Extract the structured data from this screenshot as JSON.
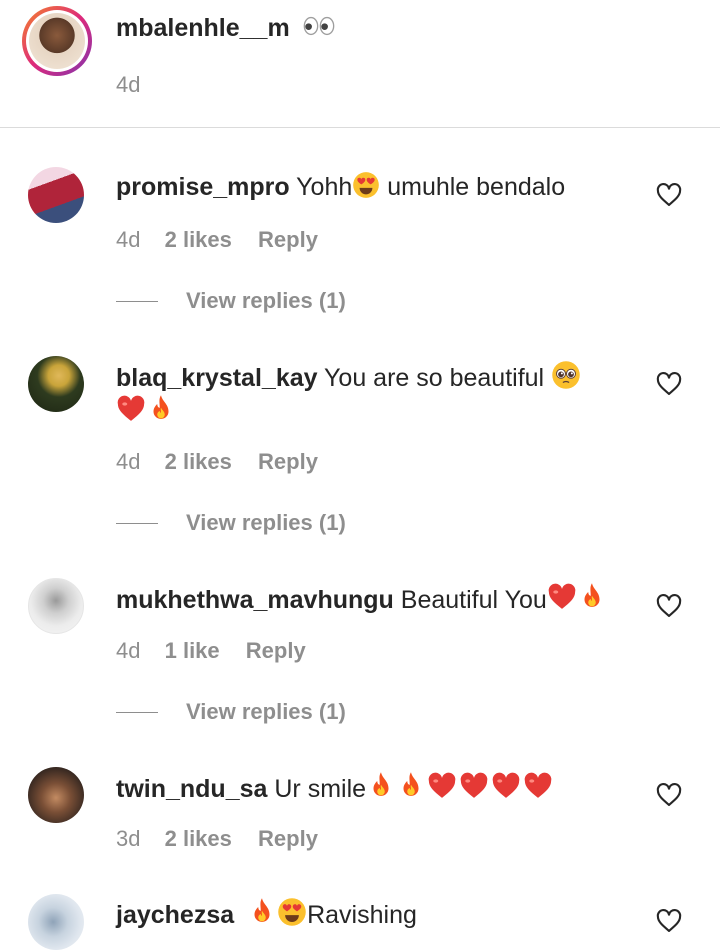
{
  "header": {
    "username": "mbalenhle__m",
    "time": "4d"
  },
  "comments": [
    {
      "username": "promise_mpro",
      "text_a": "Yohh",
      "text_b": " umuhle bendalo",
      "time": "4d",
      "likes": "2 likes",
      "reply": "Reply",
      "view_replies": "View replies (1)",
      "avatar_colors": [
        "#b0243a",
        "#3b4f7c"
      ]
    },
    {
      "username": "blaq_krystal_kay",
      "text_a": "You are so beautiful ",
      "time": "4d",
      "likes": "2 likes",
      "reply": "Reply",
      "view_replies": "View replies (1)",
      "avatar_colors": [
        "#2e3b1f",
        "#c9a43a"
      ]
    },
    {
      "username": "mukhethwa_mavhungu",
      "text_a": "Beautiful You",
      "time": "4d",
      "likes": "1 like",
      "reply": "Reply",
      "view_replies": "View replies (1)",
      "avatar_colors": [
        "#e7e7e7",
        "#8a8a8a"
      ]
    },
    {
      "username": "twin_ndu_sa",
      "text_a": "Ur smile",
      "time": "3d",
      "likes": "2 likes",
      "reply": "Reply",
      "avatar_colors": [
        "#3a2a22",
        "#c38b62"
      ]
    },
    {
      "username": "jaychezsa",
      "text_b": "Ravishing",
      "avatar_colors": [
        "#dfe6ee",
        "#8fa3b8"
      ]
    }
  ],
  "icons": {
    "heart": "heart-outline-icon",
    "fire": "fire-emoji",
    "red_heart": "red-heart-emoji",
    "heart_eyes": "heart-eyes-emoji",
    "pleading": "pleading-face-emoji",
    "eyes": "eyes-emoji"
  },
  "colors": {
    "text": "#262626",
    "muted": "#8e8e8e",
    "story_ring_start": "#f58529",
    "story_ring_end": "#dd2a7b"
  }
}
